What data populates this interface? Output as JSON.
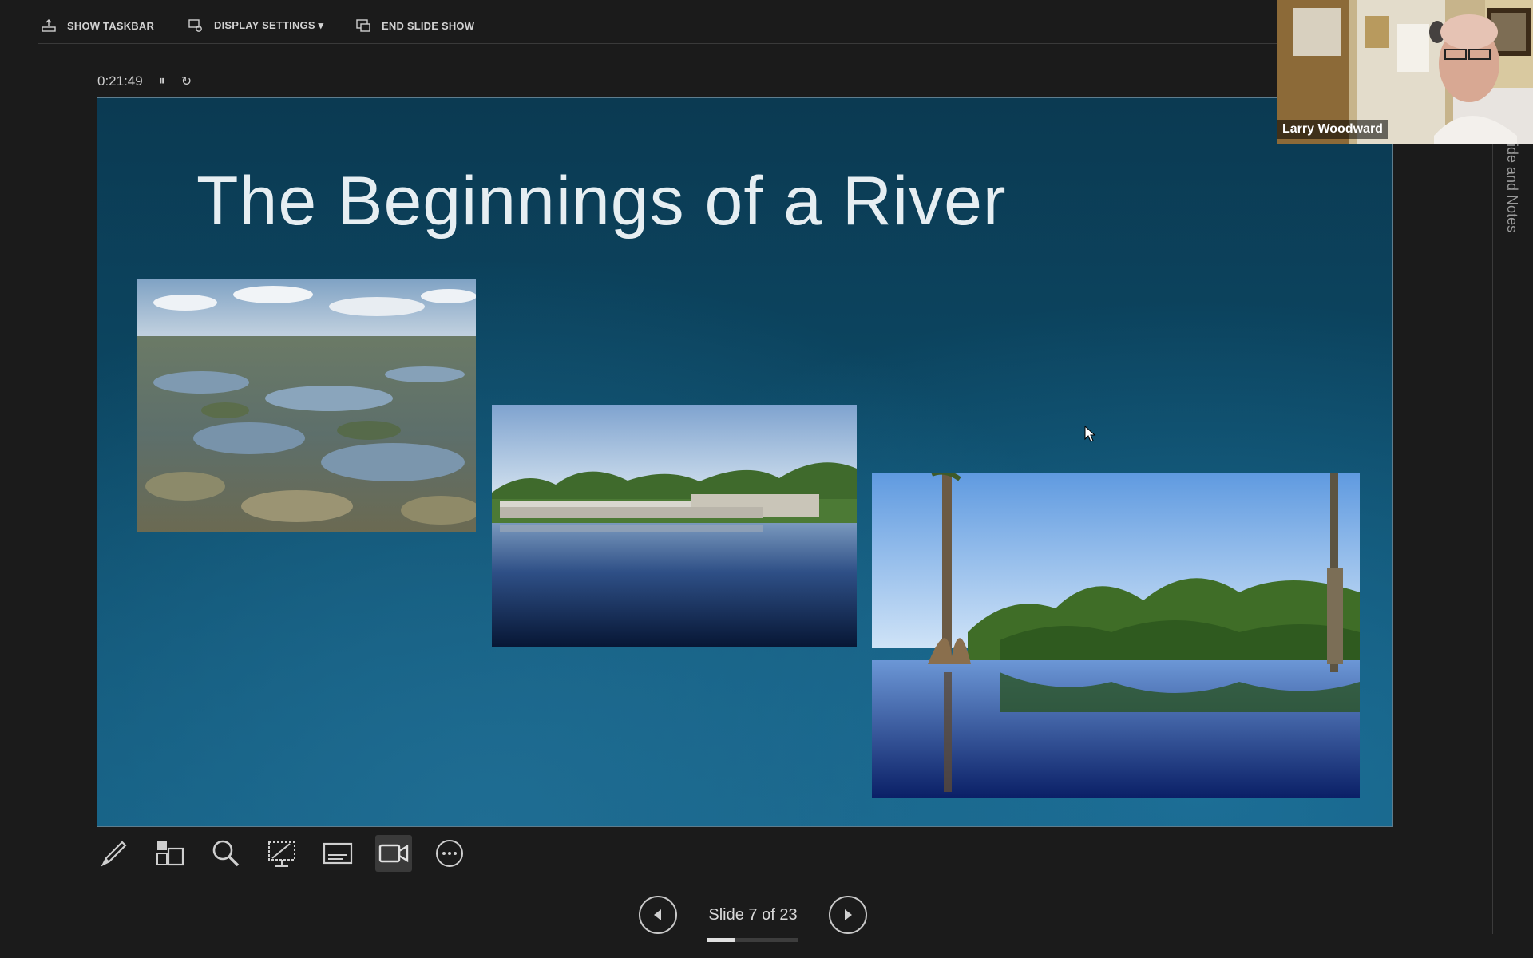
{
  "toolbar": {
    "show_taskbar": "SHOW TASKBAR",
    "display_settings": "DISPLAY SETTINGS ▾",
    "end_slide_show": "END SLIDE SHOW"
  },
  "timer": {
    "elapsed": "0:21:49",
    "pause_glyph": "⏸",
    "restart_glyph": "↻"
  },
  "slide": {
    "title": "The Beginnings of a River",
    "images": [
      "everglades-aerial-photo",
      "dam-spillway-photo",
      "cypress-river-photo"
    ]
  },
  "webcam": {
    "name": "Larry Woodward"
  },
  "side_panel": {
    "label": "ide and Notes"
  },
  "tools": [
    "pen-icon",
    "all-slides-icon",
    "zoom-icon",
    "pointer-icon",
    "subtitles-icon",
    "camera-icon",
    "more-icon"
  ],
  "navigation": {
    "label": "Slide 7 of 23",
    "current": 7,
    "total": 23
  },
  "colors": {
    "background": "#1b1b1b",
    "slide_bg": "#0c4763",
    "accent": "#e0e0e0"
  }
}
